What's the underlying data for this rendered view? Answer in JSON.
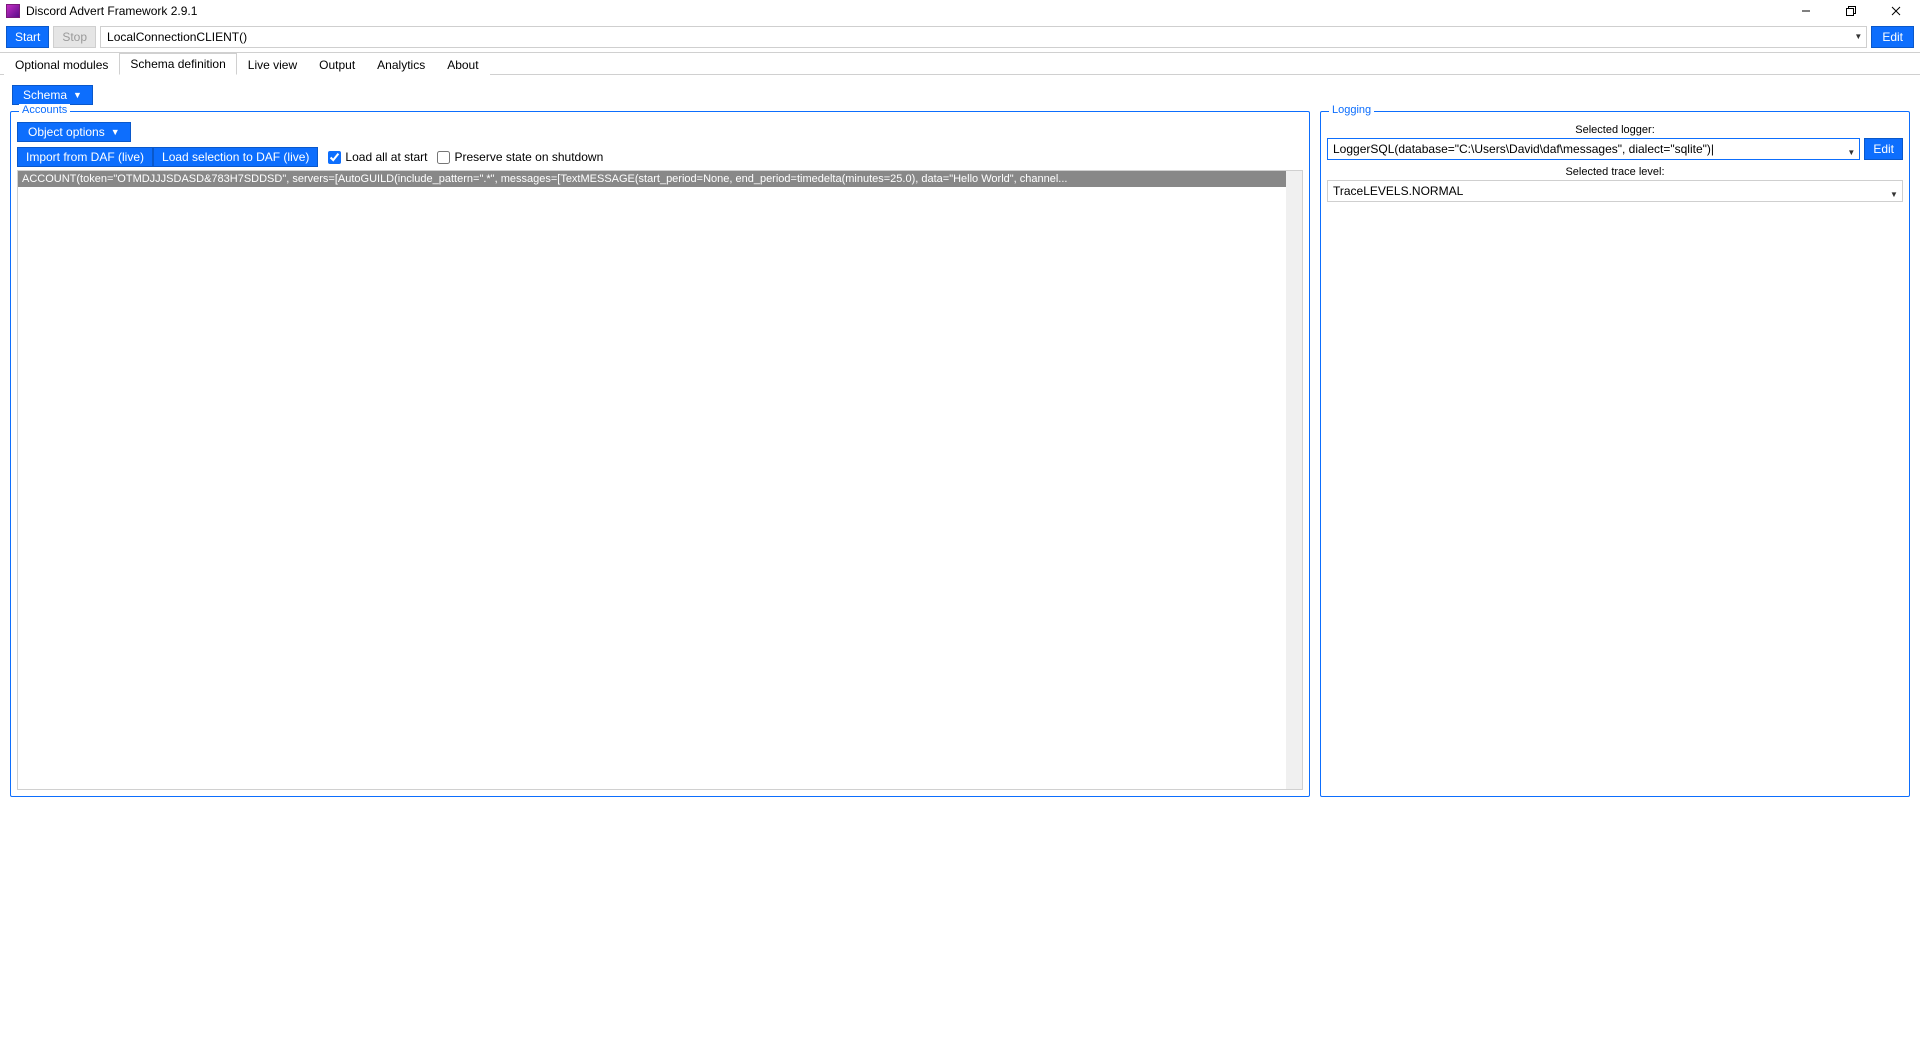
{
  "window": {
    "title": "Discord Advert Framework 2.9.1"
  },
  "toolbar": {
    "start": "Start",
    "stop": "Stop",
    "connection_value": "LocalConnectionCLIENT()",
    "edit": "Edit"
  },
  "tabs": [
    {
      "label": "Optional modules",
      "active": false
    },
    {
      "label": "Schema definition",
      "active": true
    },
    {
      "label": "Live view",
      "active": false
    },
    {
      "label": "Output",
      "active": false
    },
    {
      "label": "Analytics",
      "active": false
    },
    {
      "label": "About",
      "active": false
    }
  ],
  "schema_menu": {
    "label": "Schema"
  },
  "accounts": {
    "legend": "Accounts",
    "object_options": "Object options",
    "import_btn": "Import from DAF (live)",
    "load_btn": "Load selection to DAF (live)",
    "load_all_label": "Load all at start",
    "load_all_checked": true,
    "preserve_label": "Preserve state on shutdown",
    "preserve_checked": false,
    "items": [
      "ACCOUNT(token=\"OTMDJJJSDASD&783H7SDDSD\", servers=[AutoGUILD(include_pattern=\".*\", messages=[TextMESSAGE(start_period=None, end_period=timedelta(minutes=25.0), data=\"Hello World\", channel..."
    ]
  },
  "logging": {
    "legend": "Logging",
    "selected_logger_label": "Selected logger:",
    "logger_value": "LoggerSQL(database=\"C:\\Users\\David\\daf\\messages\", dialect=\"sqlite\")|",
    "edit": "Edit",
    "trace_label": "Selected trace level:",
    "trace_value": "TraceLEVELS.NORMAL"
  }
}
